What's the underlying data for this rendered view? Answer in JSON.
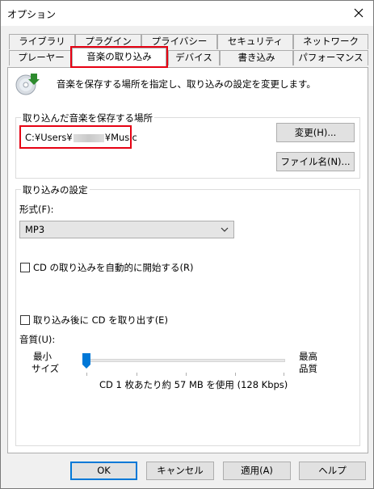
{
  "window": {
    "title": "オプション"
  },
  "tabs": {
    "row1": [
      "ライブラリ",
      "プラグイン",
      "プライバシー",
      "セキュリティ",
      "ネットワーク"
    ],
    "row2": [
      "プレーヤー",
      "音楽の取り込み",
      "デバイス",
      "書き込み",
      "パフォーマンス"
    ],
    "active": "音楽の取り込み"
  },
  "description": "音楽を保存する場所を指定し、取り込みの設定を変更します。",
  "save_location": {
    "title": "取り込んだ音楽を保存する場所",
    "path_prefix": "C:¥Users¥",
    "path_suffix": "¥Music",
    "change_button": "変更(H)...",
    "filename_button": "ファイル名(N)..."
  },
  "rip_settings": {
    "title": "取り込みの設定",
    "format_label": "形式(F):",
    "format_value": "MP3",
    "auto_rip_label": "CD の取り込みを自動的に開始する(R)",
    "auto_rip_checked": false,
    "eject_label": "取り込み後に CD を取り出す(E)",
    "eject_checked": false,
    "quality_label": "音質(U):",
    "min_label_1": "最小",
    "min_label_2": "サイズ",
    "max_label_1": "最高",
    "max_label_2": "品質",
    "quality_level": 0,
    "usage_text": "CD 1 枚あたり約 57 MB を使用 (128 Kbps)"
  },
  "footer": {
    "ok": "OK",
    "cancel": "キャンセル",
    "apply": "適用(A)",
    "help": "ヘルプ"
  },
  "colors": {
    "highlight": "#e60012",
    "default_button_border": "#0078d7"
  }
}
